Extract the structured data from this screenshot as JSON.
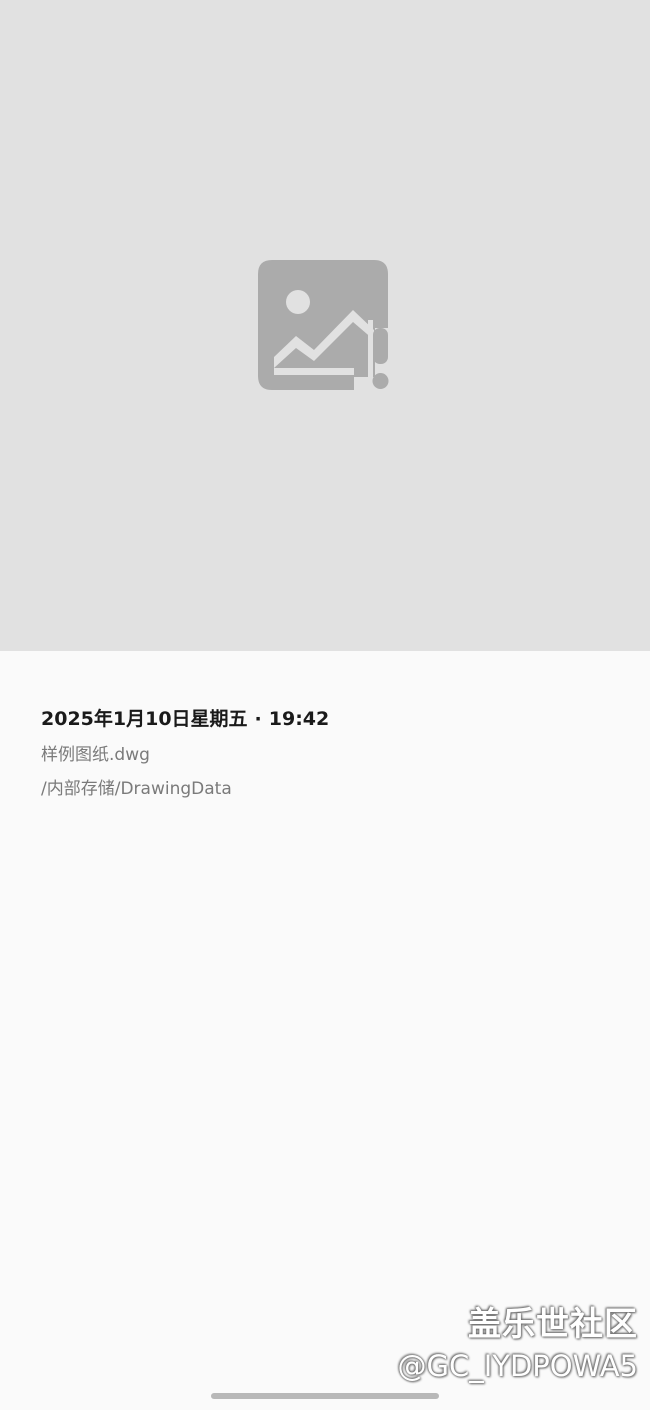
{
  "preview": {
    "icon": "image-error-icon",
    "background": "#e1e1e1",
    "icon_color": "#ababab"
  },
  "details": {
    "date": "2025年1月10日星期五",
    "separator": "·",
    "time": "19:42",
    "file_name": "样例图纸.dwg",
    "path": "/内部存储/DrawingData"
  },
  "watermark": {
    "title": "盖乐世社区",
    "user": "@GC_IYDPOWA5"
  }
}
